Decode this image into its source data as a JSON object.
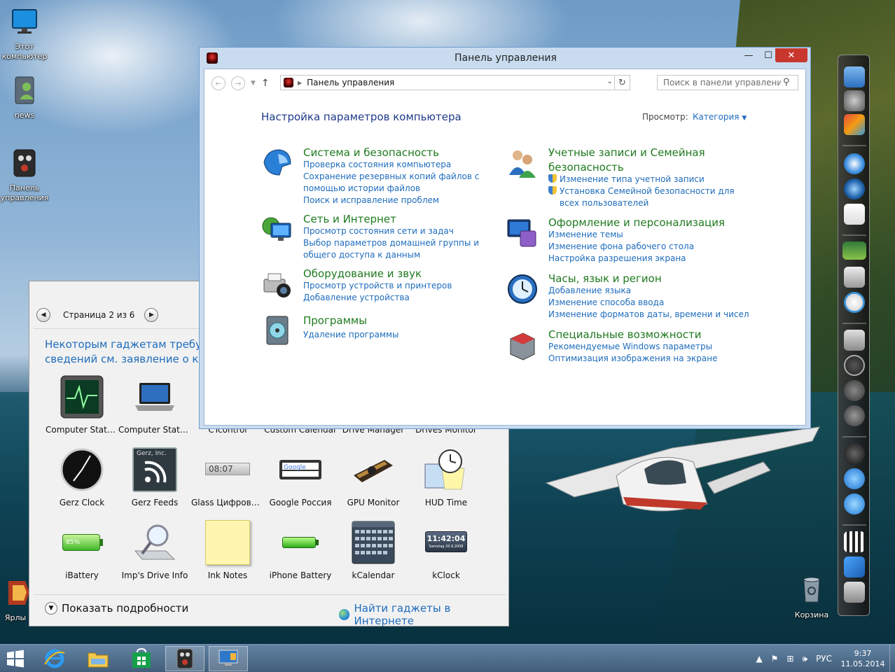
{
  "desktop": {
    "icons": [
      {
        "name": "this-pc",
        "label": "Этот компьютер"
      },
      {
        "name": "news",
        "label": "news"
      },
      {
        "name": "control-panel",
        "label": "Панель управления"
      },
      {
        "name": "shortcut",
        "label": "Ярлы"
      },
      {
        "name": "recycle-bin",
        "label": "Корзина"
      }
    ]
  },
  "gadgets": {
    "pager_label": "Страница 2 из 6",
    "notice": "Некоторым гаджетам требуется сведений см. заявление о конф",
    "notice_line1": "Некоторым гаджетам требуется",
    "notice_line2": "сведений см. заявление о конф",
    "items": [
      {
        "label": "Computer Statu...",
        "icon": "monitor-pulse-icon"
      },
      {
        "label": "Computer Statu...",
        "icon": "laptop-icon"
      },
      {
        "label": "CTcontrol",
        "icon": ""
      },
      {
        "label": "Custom Calendar",
        "icon": ""
      },
      {
        "label": "Drive Manager",
        "icon": ""
      },
      {
        "label": "Drives Monitor",
        "icon": ""
      },
      {
        "label": "Gerz Clock",
        "icon": "clock-icon"
      },
      {
        "label": "Gerz Feeds",
        "icon": "rss-icon",
        "brand": "Gerz, Inc."
      },
      {
        "label": "Glass Цифровы...",
        "icon": "digital-clock-icon",
        "time": "08:07"
      },
      {
        "label": "Google Россия",
        "icon": "search-bar-icon"
      },
      {
        "label": "GPU Monitor",
        "icon": "gpu-icon"
      },
      {
        "label": "HUD Time",
        "icon": "hud-time-icon"
      },
      {
        "label": "iBattery",
        "icon": "battery-icon",
        "percent": "85%"
      },
      {
        "label": "Imp's Drive Info",
        "icon": "magnifier-drive-icon"
      },
      {
        "label": "Ink Notes",
        "icon": "sticky-note-icon"
      },
      {
        "label": "iPhone Battery",
        "icon": "battery-green-icon"
      },
      {
        "label": "kCalendar",
        "icon": "calendar-icon"
      },
      {
        "label": "kClock",
        "icon": "kclock-icon",
        "time": "11:42:04",
        "date": "Samstag 20.9.2008"
      }
    ],
    "details_label": "Показать подробности",
    "find_online_label": "Найти гаджеты в Интернете"
  },
  "control_panel": {
    "window_title": "Панель управления",
    "address_crumb": "Панель управления",
    "search_placeholder": "Поиск в панели управления",
    "heading": "Настройка параметров компьютера",
    "view_label": "Просмотр:",
    "view_value": "Категория",
    "categories_left": [
      {
        "title": "Система и безопасность",
        "icon": "security-helmet-icon",
        "links": [
          "Проверка состояния компьютера",
          "Сохранение резервных копий файлов с помощью истории файлов",
          "Поиск и исправление проблем"
        ]
      },
      {
        "title": "Сеть и Интернет",
        "icon": "network-globe-icon",
        "links": [
          "Просмотр состояния сети и задач",
          "Выбор параметров домашней группы и общего доступа к данным"
        ]
      },
      {
        "title": "Оборудование и звук",
        "icon": "printer-camera-icon",
        "links": [
          "Просмотр устройств и принтеров",
          "Добавление устройства"
        ]
      },
      {
        "title": "Программы",
        "icon": "programs-disk-icon",
        "links": [
          "Удаление программы"
        ]
      }
    ],
    "categories_right": [
      {
        "title": "Учетные записи и Семейная безопасность",
        "icon": "users-icon",
        "links": [
          "Изменение типа учетной записи",
          "Установка Семейной безопасности для всех пользователей"
        ]
      },
      {
        "title": "Оформление и персонализация",
        "icon": "monitor-personalize-icon",
        "links": [
          "Изменение темы",
          "Изменение фона рабочего стола",
          "Настройка разрешения экрана"
        ]
      },
      {
        "title": "Часы, язык и регион",
        "icon": "clock-globe-icon",
        "links": [
          "Добавление языка",
          "Изменение способа ввода",
          "Изменение форматов даты, времени и чисел"
        ]
      },
      {
        "title": "Специальные возможности",
        "icon": "accessibility-icon",
        "links": [
          "Рекомендуемые Windows параметры",
          "Оптимизация изображения на экране"
        ]
      }
    ]
  },
  "taskbar": {
    "language": "РУС",
    "time": "9:37",
    "date": "11.05.2014"
  },
  "colors": {
    "link": "#1e6cbc",
    "category_title": "#1f7a1f",
    "heading": "#1e3a8a",
    "close_button": "#c7372e"
  }
}
